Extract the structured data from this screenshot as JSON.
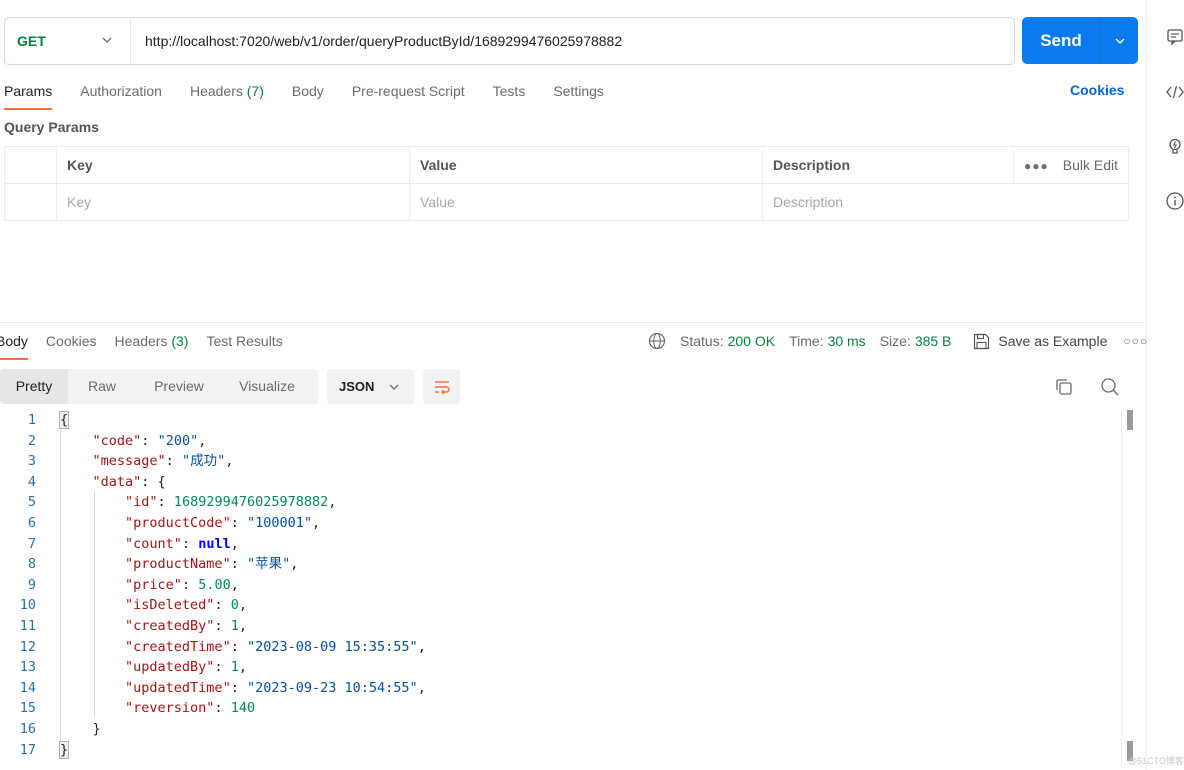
{
  "request": {
    "method": "GET",
    "url": "http://localhost:7020/web/v1/order/queryProductById/1689299476025978882",
    "send_label": "Send"
  },
  "request_tabs": [
    {
      "label": "Params",
      "active": true
    },
    {
      "label": "Authorization"
    },
    {
      "label": "Headers",
      "count": "(7)"
    },
    {
      "label": "Body"
    },
    {
      "label": "Pre-request Script"
    },
    {
      "label": "Tests"
    },
    {
      "label": "Settings"
    }
  ],
  "cookies_link": "Cookies",
  "query_params": {
    "title": "Query Params",
    "headers": {
      "key": "Key",
      "value": "Value",
      "description": "Description",
      "bulk_edit": "Bulk Edit"
    },
    "placeholders": {
      "key": "Key",
      "value": "Value",
      "description": "Description"
    }
  },
  "response_tabs": [
    {
      "label": "Body",
      "active": true
    },
    {
      "label": "Cookies"
    },
    {
      "label": "Headers",
      "count": "(3)"
    },
    {
      "label": "Test Results"
    }
  ],
  "response_meta": {
    "status_label": "Status:",
    "status_value": "200 OK",
    "time_label": "Time:",
    "time_value": "30 ms",
    "size_label": "Size:",
    "size_value": "385 B",
    "save_example": "Save as Example",
    "status_color": "#0b7f3f"
  },
  "view_modes": [
    {
      "label": "Pretty",
      "active": true
    },
    {
      "label": "Raw"
    },
    {
      "label": "Preview"
    },
    {
      "label": "Visualize"
    }
  ],
  "format": "JSON",
  "response_body": {
    "line_numbers": [
      "1",
      "2",
      "3",
      "4",
      "5",
      "6",
      "7",
      "8",
      "9",
      "10",
      "11",
      "12",
      "13",
      "14",
      "15",
      "16",
      "17"
    ],
    "code": "200",
    "message": "成功",
    "data": {
      "id": "1689299476025978882",
      "productCode": "100001",
      "count": "null",
      "productName": "苹果",
      "price": "5.00",
      "isDeleted": "0",
      "createdBy": "1",
      "createdTime": "2023-08-09 15:35:55",
      "updatedBy": "1",
      "updatedTime": "2023-09-23 10:54:55",
      "reversion": "140"
    }
  },
  "watermark": "@51CTO博客",
  "icons": {
    "sidebar": [
      "comment-icon",
      "code-icon",
      "lightbulb-icon",
      "info-icon"
    ],
    "accent": "#ff6c37",
    "send_color": "#097bed"
  }
}
